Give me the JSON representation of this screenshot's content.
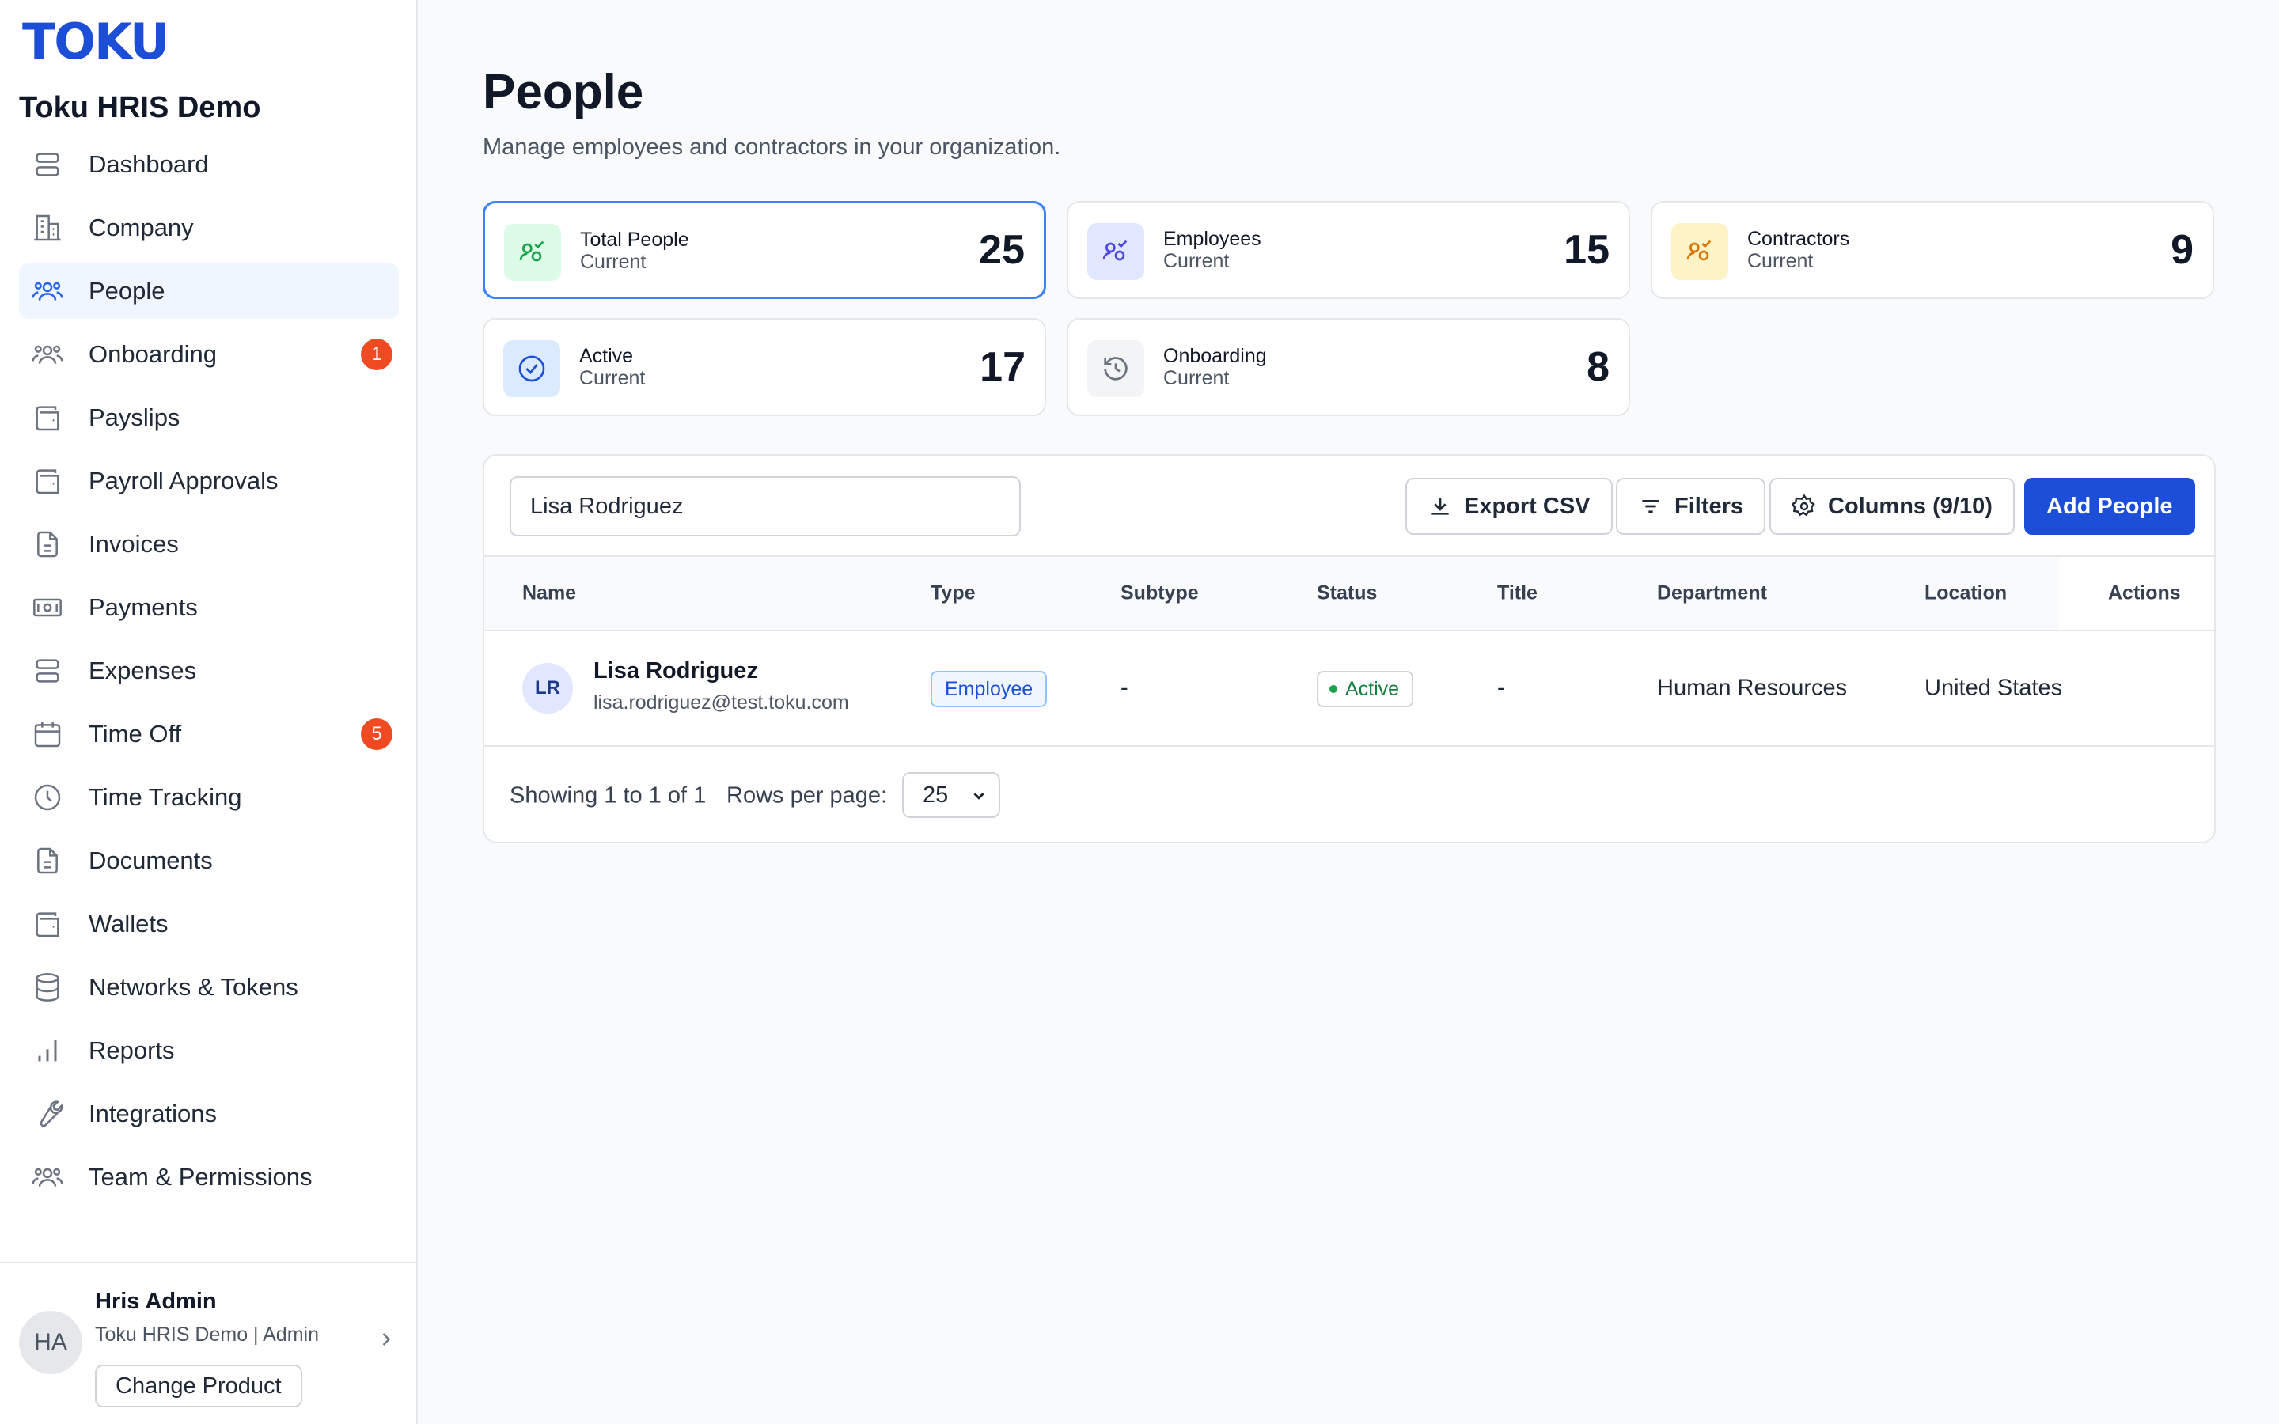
{
  "app": {
    "logo": "TOKU",
    "org_name": "Toku HRIS Demo"
  },
  "sidebar": {
    "items": [
      {
        "label": "Dashboard",
        "icon": "dashboard-icon"
      },
      {
        "label": "Company",
        "icon": "building-icon"
      },
      {
        "label": "People",
        "icon": "people-icon",
        "active": true
      },
      {
        "label": "Onboarding",
        "icon": "onboarding-icon",
        "badge": "1"
      },
      {
        "label": "Payslips",
        "icon": "wallet-icon"
      },
      {
        "label": "Payroll Approvals",
        "icon": "wallet-icon"
      },
      {
        "label": "Invoices",
        "icon": "document-icon"
      },
      {
        "label": "Payments",
        "icon": "banknote-icon"
      },
      {
        "label": "Expenses",
        "icon": "stack-icon"
      },
      {
        "label": "Time Off",
        "icon": "calendar-icon",
        "badge": "5"
      },
      {
        "label": "Time Tracking",
        "icon": "clock-icon"
      },
      {
        "label": "Documents",
        "icon": "document-icon"
      },
      {
        "label": "Wallets",
        "icon": "wallet-icon"
      },
      {
        "label": "Networks & Tokens",
        "icon": "database-icon"
      },
      {
        "label": "Reports",
        "icon": "bar-chart-icon"
      },
      {
        "label": "Integrations",
        "icon": "wrench-icon"
      },
      {
        "label": "Team & Permissions",
        "icon": "team-icon"
      }
    ]
  },
  "user": {
    "initials": "HA",
    "name": "Hris Admin",
    "role": "Toku HRIS Demo | Admin",
    "change_product_label": "Change Product"
  },
  "page": {
    "title": "People",
    "subtitle": "Manage employees and contractors in your organization."
  },
  "stats": [
    {
      "title": "Total People",
      "sub": "Current",
      "value": "25",
      "icon": "people-icon",
      "color": "#16a34a",
      "bg": "#dcfce7"
    },
    {
      "title": "Employees",
      "sub": "Current",
      "value": "15",
      "icon": "people-icon",
      "color": "#4f46e5",
      "bg": "#e0e7ff"
    },
    {
      "title": "Contractors",
      "sub": "Current",
      "value": "9",
      "icon": "people-icon",
      "color": "#d97706",
      "bg": "#fef3c7"
    },
    {
      "title": "Active",
      "sub": "Current",
      "value": "17",
      "icon": "check-circle-icon",
      "color": "#1d4ed8",
      "bg": "#dbeafe"
    },
    {
      "title": "Onboarding",
      "sub": "Current",
      "value": "8",
      "icon": "history-icon",
      "color": "#6b7280",
      "bg": "#f3f4f6"
    }
  ],
  "toolbar": {
    "search_value": "Lisa Rodriguez",
    "export_label": "Export CSV",
    "filters_label": "Filters",
    "columns_label": "Columns (9/10)",
    "add_label": "Add People"
  },
  "table": {
    "columns": [
      "Name",
      "Type",
      "Subtype",
      "Status",
      "Title",
      "Department",
      "Location",
      "Actions"
    ],
    "rows": [
      {
        "initials": "LR",
        "name": "Lisa Rodriguez",
        "email": "lisa.rodriguez@test.toku.com",
        "type": "Employee",
        "subtype": "-",
        "status": "Active",
        "title": "-",
        "department": "Human Resources",
        "location": "United States"
      }
    ]
  },
  "pagination": {
    "showing": "Showing 1 to 1 of 1",
    "rows_per_page_label": "Rows per page:",
    "rows_per_page_value": "25"
  },
  "colors": {
    "brand": "#1d4ed8",
    "badge": "#f04a23",
    "active_nav_bg": "#eff6ff"
  }
}
